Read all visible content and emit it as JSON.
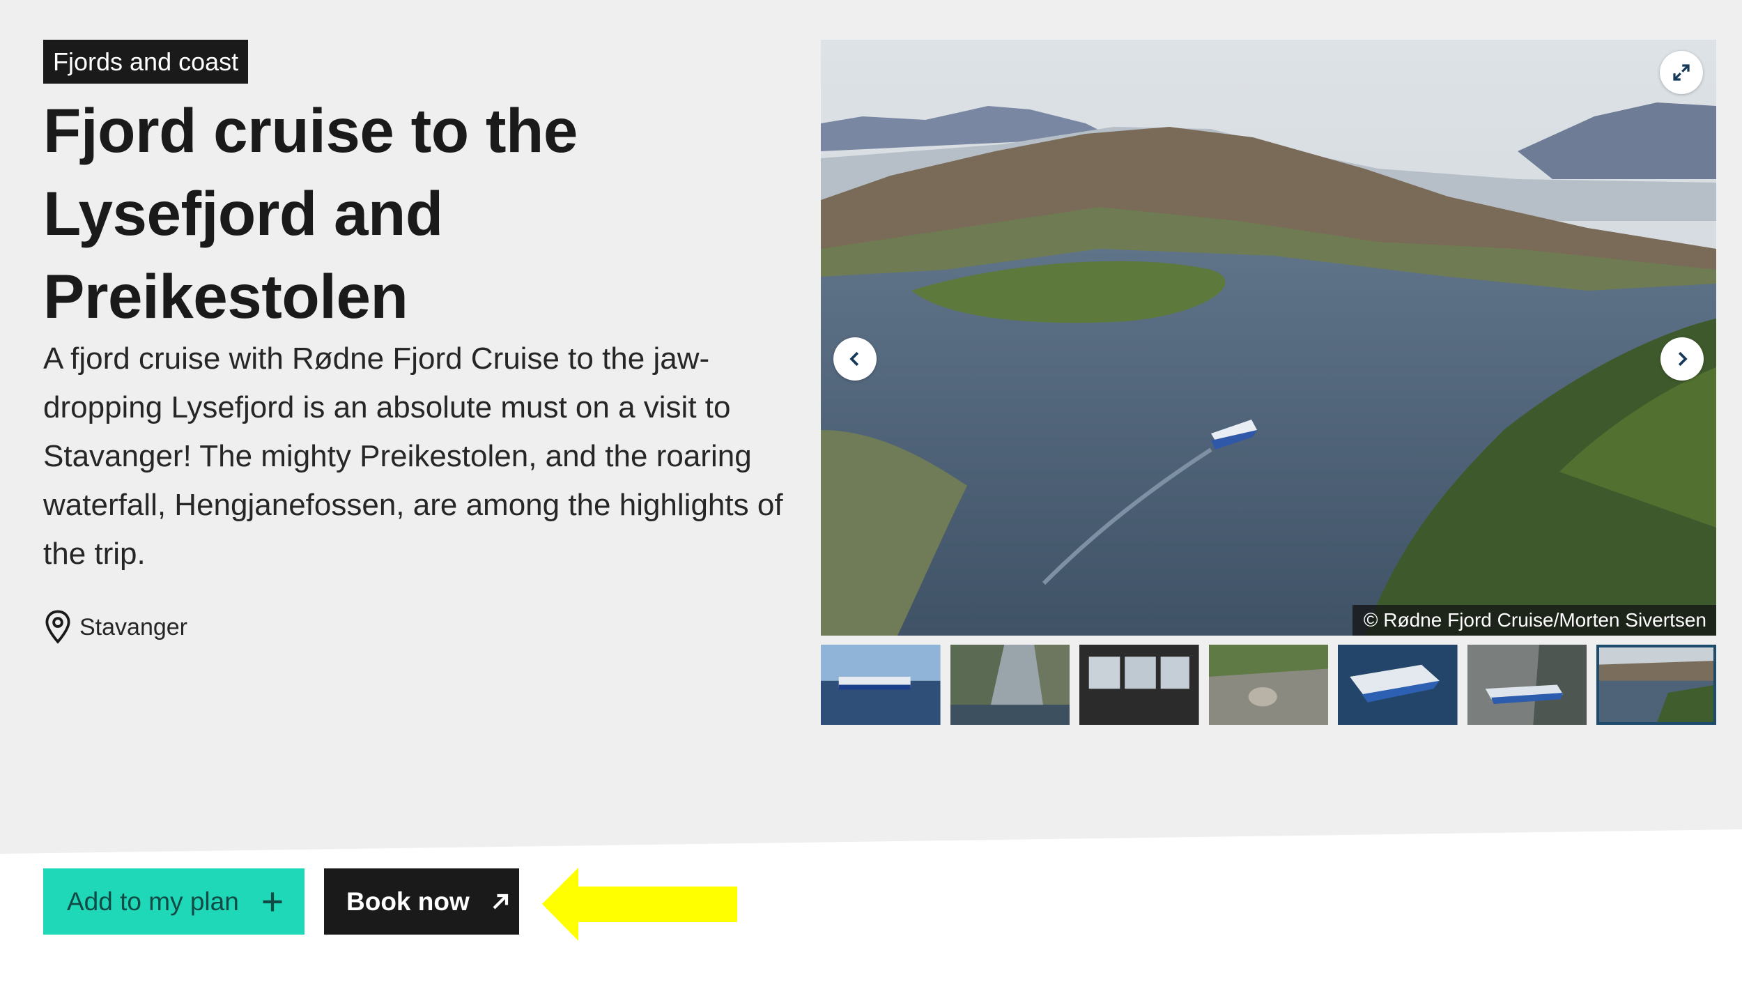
{
  "category_tag": "Fjords and coast",
  "title": "Fjord cruise to the Lysefjord and Preikestolen",
  "description": "A fjord cruise with Rødne Fjord Cruise to the jaw-dropping Lysefjord is an absolute must on a visit to Stavanger! The mighty Preikestolen, and the roaring waterfall, Hengjanefossen, are among the highlights of the trip.",
  "location": {
    "icon": "map-pin-icon",
    "name": "Stavanger"
  },
  "gallery": {
    "credit": "© Rødne Fjord Cruise/Morten Sivertsen",
    "prev_icon": "chevron-left-icon",
    "next_icon": "chevron-right-icon",
    "expand_icon": "expand-icon",
    "thumbnail_count": 7,
    "active_thumbnail": 7
  },
  "actions": {
    "add_to_plan": "Add to my plan",
    "book_now": "Book now"
  },
  "colors": {
    "hero_background": "#efefef",
    "add_plan_button": "#1ed8b8",
    "book_button": "#1a1a1a",
    "annotation_arrow": "#ffff00"
  }
}
